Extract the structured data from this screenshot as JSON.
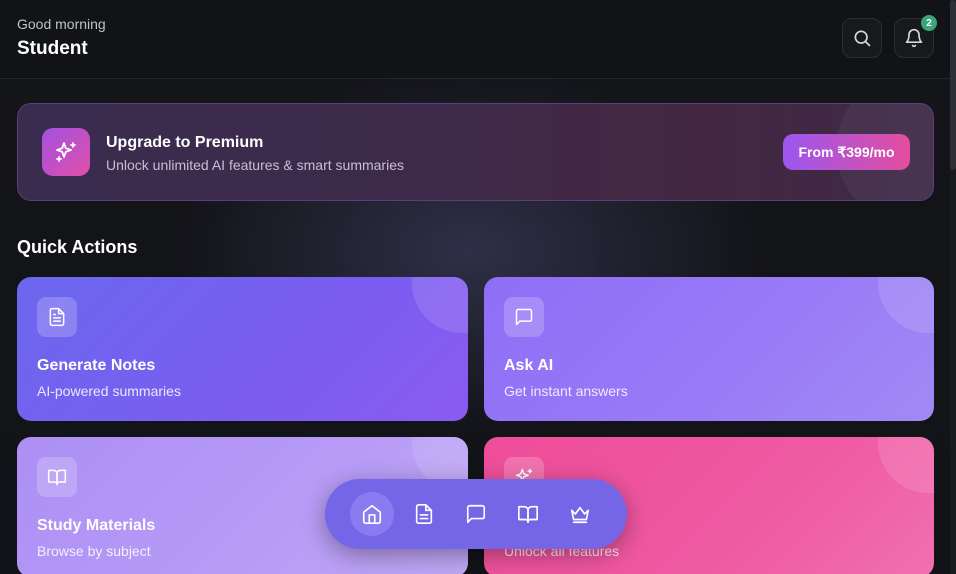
{
  "header": {
    "greeting": "Good morning",
    "user_name": "Student",
    "notification_count": "2",
    "search_icon": "search-icon",
    "bell_icon": "bell-icon"
  },
  "promo": {
    "icon": "sparkles-icon",
    "title": "Upgrade to Premium",
    "subtitle": "Unlock unlimited AI features & smart summaries",
    "button_label": "From ₹399/mo"
  },
  "quick_actions": {
    "title": "Quick Actions",
    "cards": [
      {
        "title": "Generate Notes",
        "subtitle": "AI-powered summaries",
        "icon": "document-icon"
      },
      {
        "title": "Ask AI",
        "subtitle": "Get instant answers",
        "icon": "chat-icon"
      },
      {
        "title": "Study Materials",
        "subtitle": "Browse by subject",
        "icon": "book-icon"
      },
      {
        "title": "",
        "subtitle": "Unlock all features",
        "icon": "sparkles-icon"
      }
    ]
  },
  "bottom_nav": {
    "items": [
      {
        "icon": "home-icon",
        "active": true
      },
      {
        "icon": "document-icon",
        "active": false
      },
      {
        "icon": "chat-icon",
        "active": false
      },
      {
        "icon": "book-icon",
        "active": false
      },
      {
        "icon": "crown-icon",
        "active": false
      }
    ]
  },
  "colors": {
    "background": "#0f1014",
    "accent_purple": "#7b5cf1",
    "accent_pink": "#ee4d98",
    "badge_green": "#3aa57a"
  }
}
